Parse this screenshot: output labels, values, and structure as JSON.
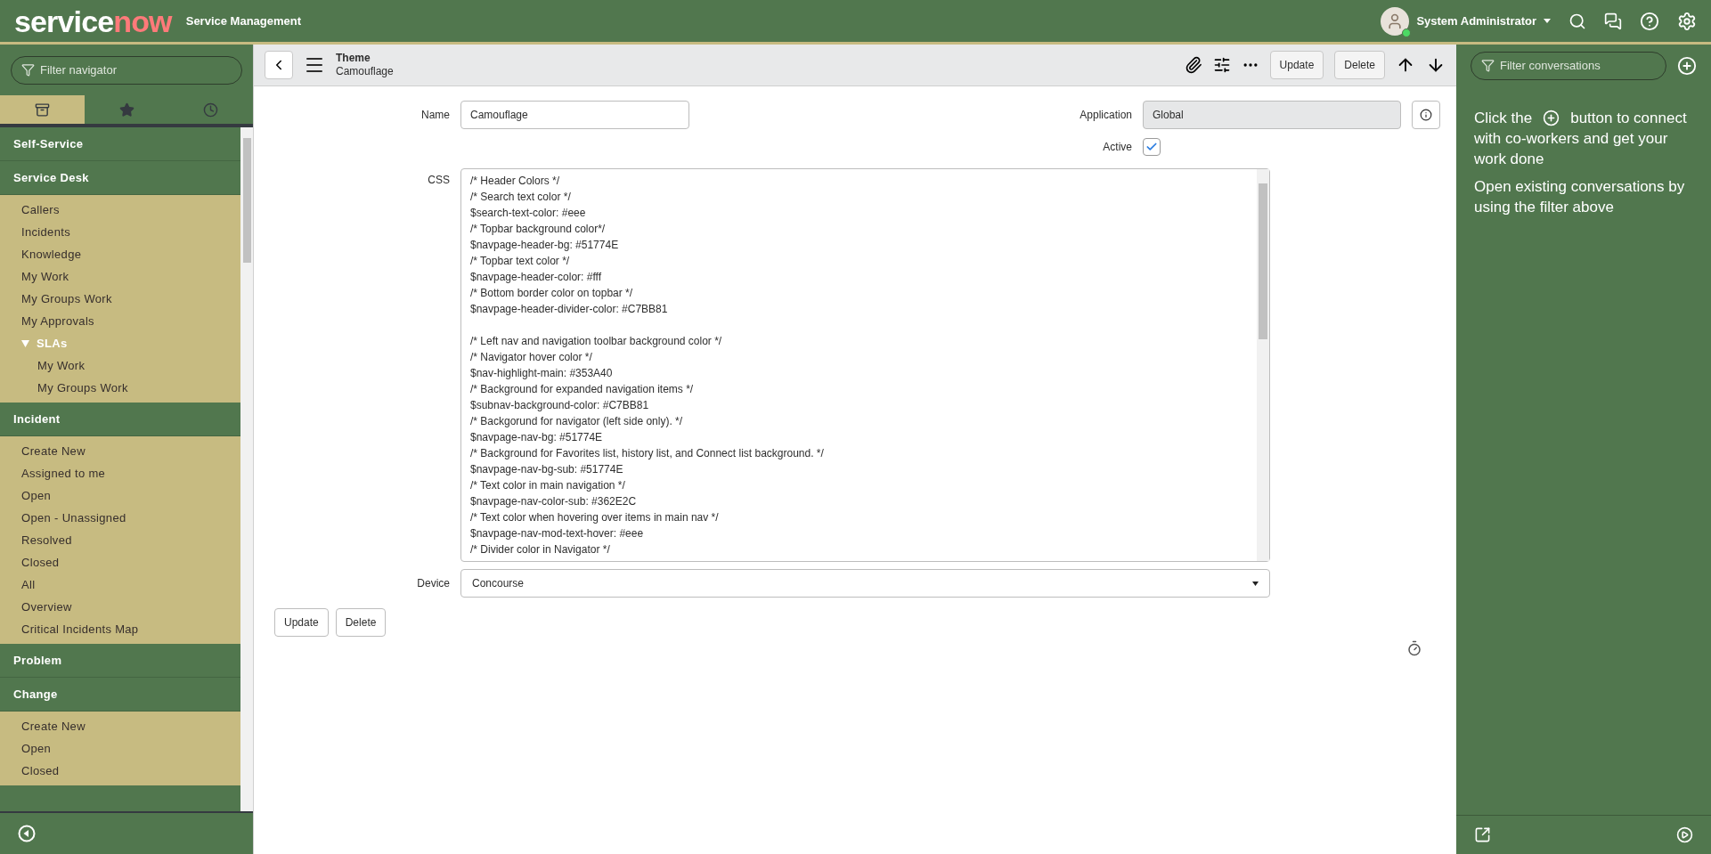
{
  "header": {
    "logo": {
      "part_1": "service",
      "part_2": "now"
    },
    "product": "Service Management",
    "user": {
      "name": "System Administrator",
      "online": true
    }
  },
  "navigator": {
    "filter": {
      "placeholder": "Filter navigator"
    },
    "tabs": [
      {
        "kind": "all",
        "selected": true
      },
      {
        "kind": "favorites",
        "selected": false
      },
      {
        "kind": "history",
        "selected": false
      }
    ],
    "sections": [
      {
        "label": "Self-Service"
      },
      {
        "label": "Service Desk",
        "items": [
          {
            "label": "Callers"
          },
          {
            "label": "Incidents"
          },
          {
            "label": "Knowledge"
          },
          {
            "label": "My Work"
          },
          {
            "label": "My Groups Work"
          },
          {
            "label": "My Approvals"
          },
          {
            "label": "SLAs",
            "expanded": true,
            "children": [
              {
                "label": "My Work"
              },
              {
                "label": "My Groups Work"
              }
            ]
          }
        ]
      },
      {
        "label": "Incident",
        "items": [
          {
            "label": "Create New"
          },
          {
            "label": "Assigned to me"
          },
          {
            "label": "Open"
          },
          {
            "label": "Open - Unassigned"
          },
          {
            "label": "Resolved"
          },
          {
            "label": "Closed"
          },
          {
            "label": "All"
          },
          {
            "label": "Overview"
          },
          {
            "label": "Critical Incidents Map"
          }
        ]
      },
      {
        "label": "Problem"
      },
      {
        "label": "Change",
        "items": [
          {
            "label": "Create New"
          },
          {
            "label": "Open"
          },
          {
            "label": "Closed"
          }
        ]
      }
    ]
  },
  "form": {
    "title": "Theme",
    "subtitle": "Camouflage",
    "header_buttons": [
      "Update",
      "Delete"
    ],
    "name": {
      "label": "Name",
      "value": "Camouflage"
    },
    "application": {
      "label": "Application",
      "value": "Global"
    },
    "active": {
      "label": "Active",
      "checked": true
    },
    "css": {
      "label": "CSS",
      "groups": [
        [
          "/* Header Colors */",
          "/* Search text color */",
          "$search-text-color: #eee",
          "/* Topbar background color*/",
          "$navpage-header-bg: #51774E",
          "/* Topbar text color */",
          "$navpage-header-color: #fff",
          "/* Bottom border color on topbar */",
          "$navpage-header-divider-color: #C7BB81"
        ],
        [
          "/* Left nav and navigation toolbar background color */",
          "/* Navigator hover color */",
          "$nav-highlight-main: #353A40",
          "/* Background for expanded navigation items */",
          "$subnav-background-color: #C7BB81",
          "/* Backgorund for navigator (left side only). */",
          "$navpage-nav-bg: #51774E",
          "/* Background for Favorites list, history list, and Connect list background. */",
          "$navpage-nav-bg-sub: #51774E",
          "/* Text color in main navigation */",
          "$navpage-nav-color-sub: #362E2C",
          "/* Text color when hovering over items in main nav */",
          "$navpage-nav-mod-text-hover: #eee",
          "/* Divider color in Navigator */"
        ]
      ]
    },
    "device": {
      "label": "Device",
      "value": "Concourse"
    },
    "footer_buttons": [
      "Update",
      "Delete"
    ]
  },
  "connect": {
    "filter": {
      "placeholder": "Filter conversations"
    },
    "hint_before": "Click the",
    "hint_after": "button to connect",
    "hint_after_2": "with co-workers and get your work done",
    "hint_2": "Open existing conversations by using the filter above"
  }
}
